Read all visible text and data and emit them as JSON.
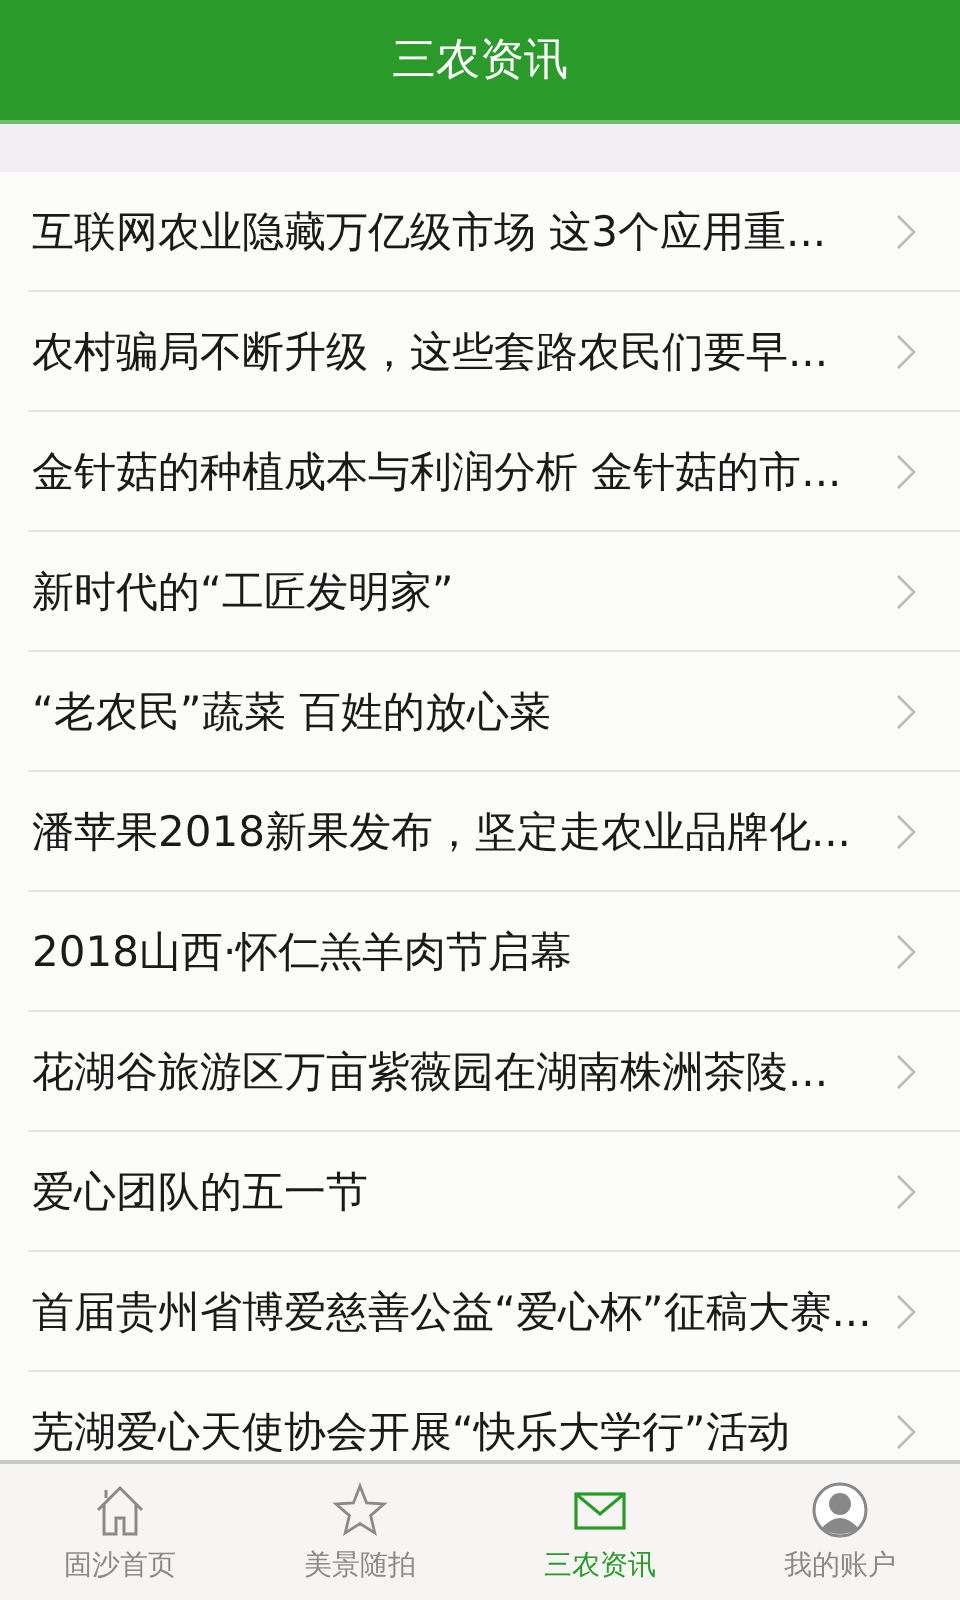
{
  "header": {
    "title": "三农资讯"
  },
  "news": [
    {
      "title": "互联网农业隐藏万亿级市场 这3个应用重..."
    },
    {
      "title": "农村骗局不断升级，这些套路农民们要早..."
    },
    {
      "title": "金针菇的种植成本与利润分析 金针菇的市..."
    },
    {
      "title": "新时代的“工匠发明家”"
    },
    {
      "title": "“老农民”蔬菜 百姓的放心菜"
    },
    {
      "title": "潘苹果2018新果发布，坚定走农业品牌化..."
    },
    {
      "title": "2018山西·怀仁羔羊肉节启幕"
    },
    {
      "title": "花湖谷旅游区万亩紫薇园在湖南株洲茶陵..."
    },
    {
      "title": "爱心团队的五一节"
    },
    {
      "title": "首届贵州省博爱慈善公益“爱心杯”征稿大赛..."
    },
    {
      "title": "芜湖爱心天使协会开展“快乐大学行”活动"
    }
  ],
  "tabs": [
    {
      "label": "固沙首页",
      "selected": false
    },
    {
      "label": "美景随拍",
      "selected": false
    },
    {
      "label": "三农资讯",
      "selected": true
    },
    {
      "label": "我的账户",
      "selected": false
    }
  ]
}
